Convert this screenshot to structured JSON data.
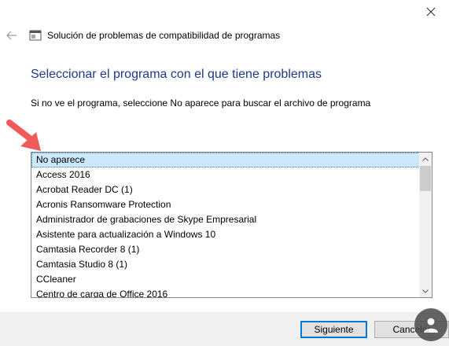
{
  "window": {
    "title_icon": "app-window-icon"
  },
  "header": {
    "title": "Solución de problemas de compatibilidad de programas"
  },
  "main": {
    "heading": "Seleccionar el programa con el que tiene problemas",
    "instruction": "Si no ve el programa, seleccione No aparece para buscar el archivo de programa",
    "programs": [
      "No aparece",
      "Access 2016",
      "Acrobat Reader DC (1)",
      "Acronis Ransomware Protection",
      "Administrador de grabaciones de Skype Empresarial",
      "Asistente para actualización a Windows 10",
      "Camtasia Recorder 8 (1)",
      "Camtasia Studio 8 (1)",
      "CCleaner",
      "Centro de carga de Office 2016"
    ],
    "selected_index": 0
  },
  "footer": {
    "next_label": "Siguiente",
    "cancel_label": "Cancelar"
  },
  "colors": {
    "heading": "#1e3a8a",
    "selection": "#cce8ff",
    "arrow": "#f25a5a",
    "accent": "#0078d7"
  }
}
